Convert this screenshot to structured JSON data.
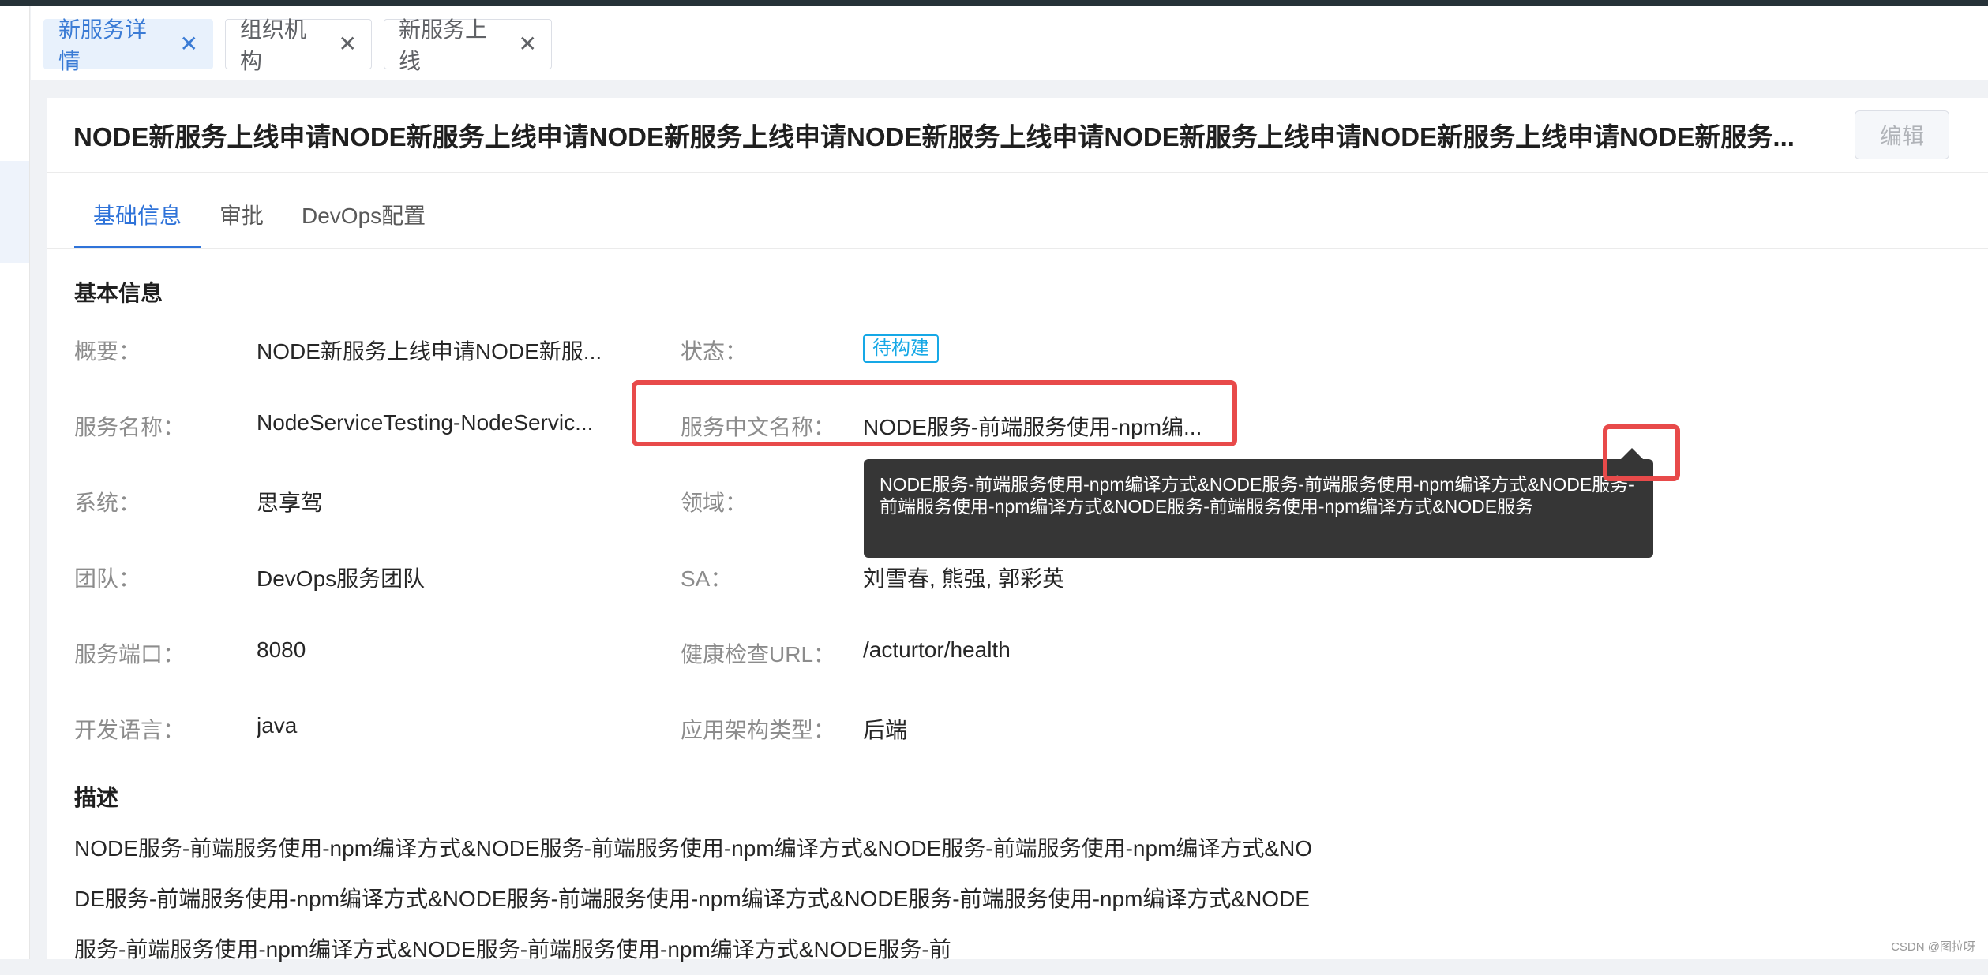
{
  "page_tabs": [
    {
      "label": "新服务详情",
      "active": true
    },
    {
      "label": "组织机构",
      "active": false
    },
    {
      "label": "新服务上线",
      "active": false
    }
  ],
  "header": {
    "title": "NODE新服务上线申请NODE新服务上线申请NODE新服务上线申请NODE新服务上线申请NODE新服务上线申请NODE新服务上线申请NODE新服务...",
    "edit_label": "编辑"
  },
  "nav_tabs": [
    {
      "label": "基础信息",
      "active": true
    },
    {
      "label": "审批",
      "active": false
    },
    {
      "label": "DevOps配置",
      "active": false
    }
  ],
  "basic": {
    "section_title": "基本信息",
    "fields": {
      "summary": {
        "label": "概要：",
        "value": "NODE新服务上线申请NODE新服..."
      },
      "status": {
        "label": "状态：",
        "value": "待构建"
      },
      "service_name": {
        "label": "服务名称：",
        "value": "NodeServiceTesting-NodeServic..."
      },
      "service_cn_name": {
        "label": "服务中文名称：",
        "value": "NODE服务-前端服务使用-npm编..."
      },
      "system": {
        "label": "系统：",
        "value": "思享驾"
      },
      "domain": {
        "label": "领域：",
        "value": ""
      },
      "team": {
        "label": "团队：",
        "value": "DevOps服务团队"
      },
      "sa": {
        "label": "SA：",
        "value": "刘雪春, 熊强, 郭彩英"
      },
      "port": {
        "label": "服务端口：",
        "value": "8080"
      },
      "health_url": {
        "label": "健康检查URL：",
        "value": "/acturtor/health"
      },
      "language": {
        "label": "开发语言：",
        "value": "java"
      },
      "arch_type": {
        "label": "应用架构类型：",
        "value": "后端"
      }
    }
  },
  "description": {
    "section_title": "描述",
    "text": "NODE服务-前端服务使用-npm编译方式&NODE服务-前端服务使用-npm编译方式&NODE服务-前端服务使用-npm编译方式&NODE服务-前端服务使用-npm编译方式&NODE服务-前端服务使用-npm编译方式&NODE服务-前端服务使用-npm编译方式&NODE服务-前端服务使用-npm编译方式&NODE服务-前端服务使用-npm编译方式&NODE服务-前"
  },
  "tooltip": {
    "text": "NODE服务-前端服务使用-npm编译方式&NODE服务-前端服务使用-npm编译方式&NODE服务-前端服务使用-npm编译方式&NODE服务-前端服务使用-npm编译方式&NODE服务"
  },
  "watermark": "CSDN @图拉呀",
  "colors": {
    "accent": "#2f73d9",
    "status_badge": "#16a8e6",
    "highlight": "#e84a4a",
    "tooltip_bg": "#363636"
  }
}
